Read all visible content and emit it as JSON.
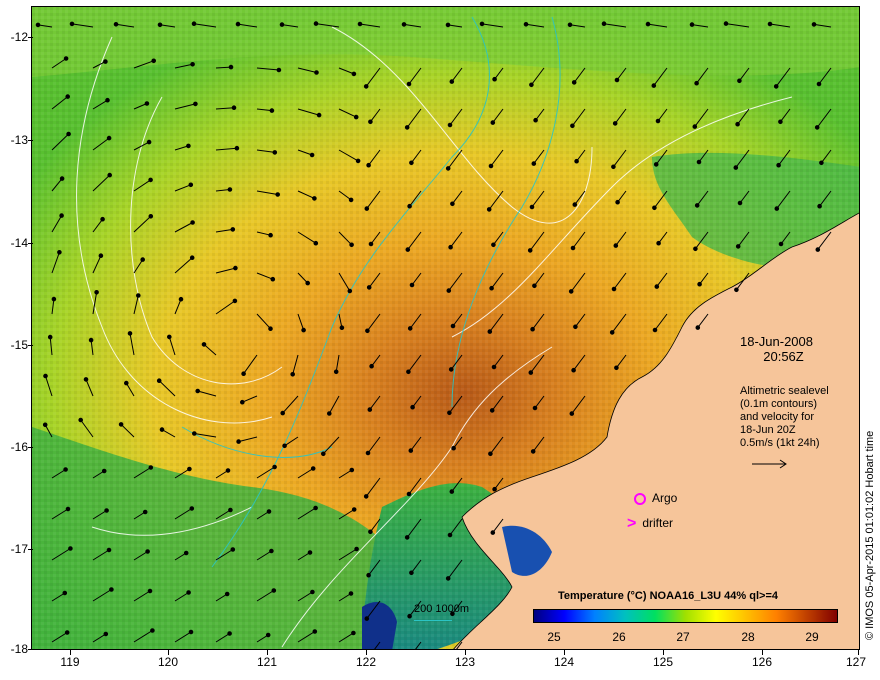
{
  "axes": {
    "latitude_ticks": [
      "-12",
      "-13",
      "-14",
      "-15",
      "-16",
      "-17",
      "-18"
    ],
    "longitude_ticks": [
      "119",
      "120",
      "121",
      "122",
      "123",
      "124",
      "125",
      "126",
      "127"
    ],
    "lat_range": [
      -18,
      -11.95
    ],
    "lon_range": [
      118.6,
      127
    ]
  },
  "annotation": {
    "date": "18-Jun-2008",
    "time": "20:56Z",
    "note_lines": [
      "Altimetric sealevel",
      "(0.1m contours)",
      "and velocity for",
      "18-Jun 20Z",
      "0.5m/s (1kt 24h)"
    ]
  },
  "legend": {
    "argo_label": "Argo",
    "drifter_label": "drifter",
    "drifter_symbol": ">",
    "symbol_color": "#ff00ff"
  },
  "colorbar": {
    "title": "Temperature (°C) NOAA16_L3U 44% ql>=4",
    "labels": [
      "25",
      "26",
      "27",
      "28",
      "29"
    ],
    "range": [
      24.6,
      29.6
    ],
    "colors": [
      "#000080",
      "#0000ff",
      "#0080ff",
      "#00c0c0",
      "#00e060",
      "#a0e000",
      "#ffff00",
      "#ffc000",
      "#ff8000",
      "#c04000",
      "#800000"
    ]
  },
  "depth_legend": {
    "label": "200  1000m",
    "color": "#2bc4c4"
  },
  "credit": "© IMOS 05-Apr-2015 01:01:02 Hobart time",
  "land_color": "#f6c59a",
  "sea_colors": {
    "warm_core": "#c87020",
    "warm": "#e8a020",
    "mild": "#f0c020",
    "cool": "#a0d020",
    "cooler": "#40b040",
    "coastal": "#20a080",
    "coldest": "#1040a0"
  }
}
